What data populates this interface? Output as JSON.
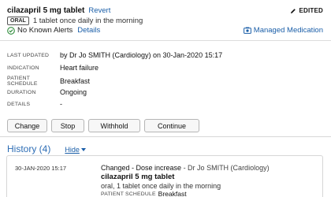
{
  "medication": {
    "name": "cilazapril 5 mg tablet",
    "revert_label": "Revert",
    "edited_label": "EDITED",
    "route": "ORAL",
    "dose_instructions": "1 tablet once daily in the morning",
    "alerts_text": "No Known Alerts",
    "details_label": "Details",
    "managed_label": "Managed Medication"
  },
  "info": [
    {
      "label": "LAST UPDATED",
      "value": "by Dr Jo SMITH (Cardiology) on 30-Jan-2020 15:17"
    },
    {
      "label": "INDICATION",
      "value": "Heart failure"
    },
    {
      "label": "PATIENT SCHEDULE",
      "value": "Breakfast"
    },
    {
      "label": "DURATION",
      "value": "Ongoing"
    },
    {
      "label": "DETAILS",
      "value": "-"
    }
  ],
  "actions": {
    "change": "Change",
    "stop": "Stop",
    "withhold": "Withhold",
    "continue": "Continue"
  },
  "history": {
    "title": "History (4)",
    "hide_label": "Hide",
    "entry": {
      "date": "30-JAN-2020 15:17",
      "change": "Changed - Dose increase",
      "by": " - Dr Jo SMITH (Cardiology)",
      "med": "cilazapril 5 mg tablet",
      "dose": "oral, 1 tablet once daily in the morning",
      "schedule_label": "PATIENT SCHEDULE",
      "schedule_value": "Breakfast"
    }
  },
  "colors": {
    "link": "#1a5ea8",
    "history_title": "#2d6db5",
    "alert_ok": "#2e8b3a"
  }
}
